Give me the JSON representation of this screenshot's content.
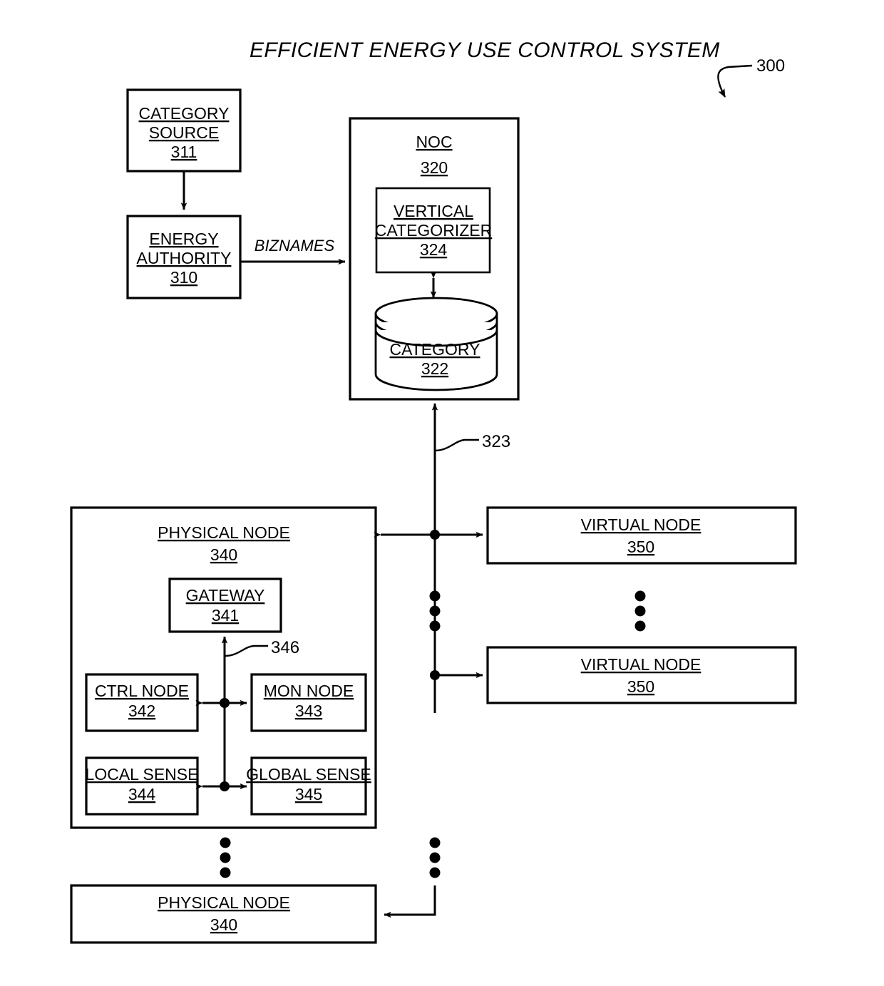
{
  "figure": {
    "title": "EFFICIENT ENERGY USE CONTROL SYSTEM",
    "figure_ref": "300"
  },
  "boxes": {
    "category_source": {
      "line1": "CATEGORY",
      "line2": "SOURCE",
      "ref": "311"
    },
    "energy_authority": {
      "line1": "ENERGY",
      "line2": "AUTHORITY",
      "ref": "310"
    },
    "noc": {
      "line1": "NOC",
      "ref": "320"
    },
    "vertical_categorizer": {
      "line1": "VERTICAL",
      "line2": "CATEGORIZER",
      "ref": "324"
    },
    "category_db": {
      "line1": "CATEGORY",
      "ref": "322"
    },
    "physical_node_top": {
      "line1": "PHYSICAL NODE",
      "ref": "340"
    },
    "physical_node_bottom": {
      "line1": "PHYSICAL NODE",
      "ref": "340"
    },
    "gateway": {
      "line1": "GATEWAY",
      "ref": "341"
    },
    "ctrl_node": {
      "line1": "CTRL NODE",
      "ref": "342"
    },
    "mon_node": {
      "line1": "MON NODE",
      "ref": "343"
    },
    "local_sense": {
      "line1": "LOCAL SENSE",
      "ref": "344"
    },
    "global_sense": {
      "line1": "GLOBAL SENSE",
      "ref": "345"
    },
    "virtual_node_top": {
      "line1": "VIRTUAL NODE",
      "ref": "350"
    },
    "virtual_node_bottom": {
      "line1": "VIRTUAL NODE",
      "ref": "350"
    }
  },
  "edges": {
    "biznames_label": "BIZNAMES",
    "bus_ref": "323",
    "internal_bus_ref": "346"
  },
  "colors": {
    "stroke": "#000000",
    "fill": "#ffffff"
  }
}
